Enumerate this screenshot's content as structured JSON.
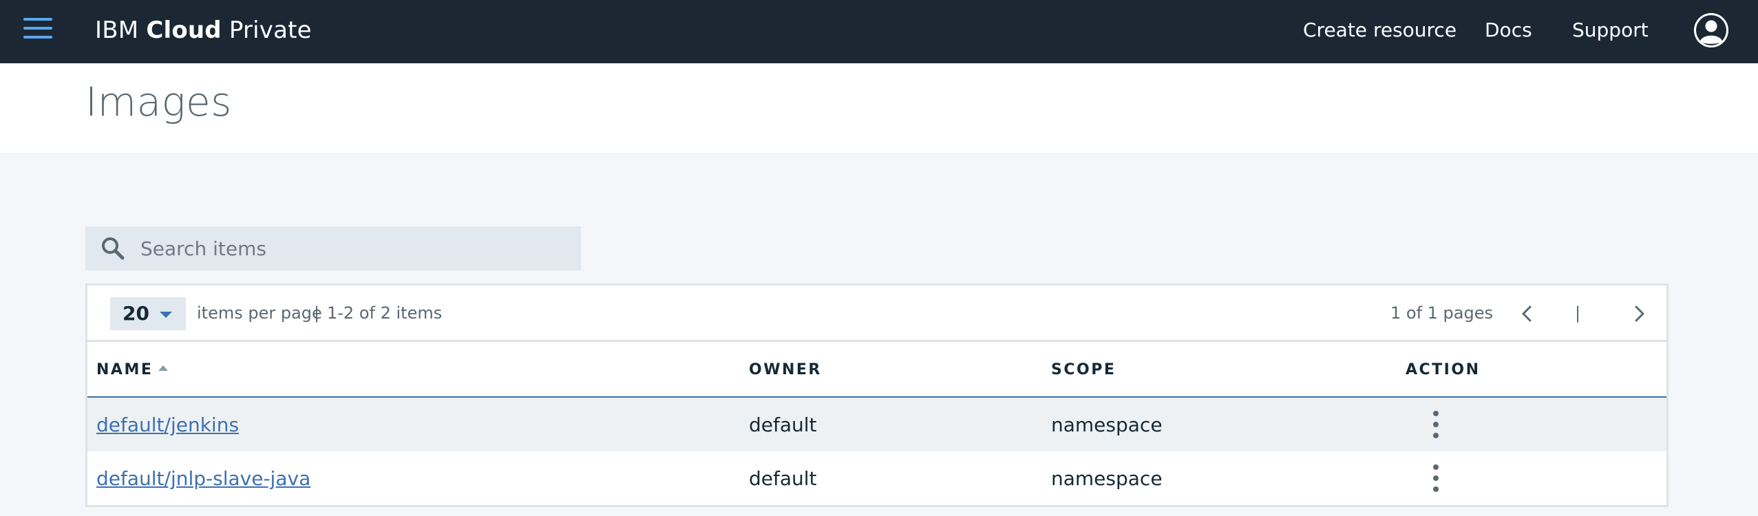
{
  "header": {
    "brand_prefix": "IBM",
    "brand_bold": "Cloud",
    "brand_suffix": "Private",
    "nav": {
      "create_resource": "Create resource",
      "docs": "Docs",
      "support": "Support"
    },
    "icons": {
      "menu": "hamburger-menu-icon",
      "user": "user-avatar-icon"
    },
    "background_color": "#1b2834",
    "accent_color": "#5aa9f0"
  },
  "page": {
    "title": "Images"
  },
  "search": {
    "placeholder": "Search items",
    "value": "",
    "icon": "search-icon"
  },
  "pagination": {
    "page_size": "20",
    "items_per_page_label": "items per page",
    "separator": "|",
    "range_label": "1-2 of 2 items",
    "page_info": "1 of 1 pages",
    "divider": "|",
    "icons": {
      "prev": "chevron-left-icon",
      "next": "chevron-right-icon",
      "page_size_caret": "caret-down-icon"
    }
  },
  "table": {
    "columns": {
      "name": "NAME",
      "owner": "OWNER",
      "scope": "SCOPE",
      "action": "ACTION"
    },
    "sort": {
      "column": "name",
      "direction": "ascending"
    },
    "rows": [
      {
        "name": "default/jenkins",
        "owner": "default",
        "scope": "namespace",
        "action_icon": "overflow-menu-icon"
      },
      {
        "name": "default/jnlp-slave-java",
        "owner": "default",
        "scope": "namespace",
        "action_icon": "overflow-menu-icon"
      }
    ],
    "link_color": "#3d70b2"
  }
}
